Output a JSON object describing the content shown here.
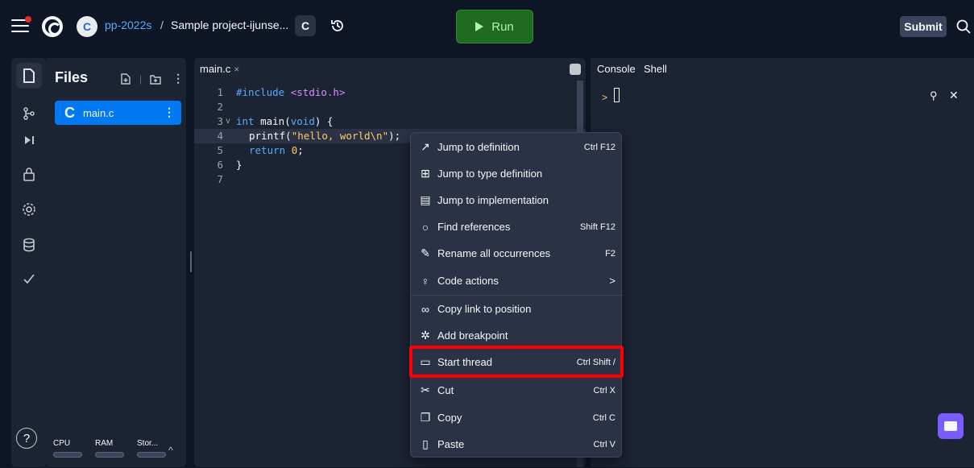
{
  "topbar": {
    "org": "pp-2022s",
    "separator": "/",
    "project": "Sample project-ijunse...",
    "lang_badge": "C",
    "run_label": "Run",
    "submit_label": "Submit"
  },
  "files_panel": {
    "title": "Files",
    "file_lang": "C",
    "file_name": "main.c",
    "resources": [
      "CPU",
      "RAM",
      "Stor..."
    ]
  },
  "editor": {
    "tab_label": "main.c",
    "tab_close": "×",
    "lines": [
      {
        "n": "1"
      },
      {
        "n": "2"
      },
      {
        "n": "3",
        "fold": "v"
      },
      {
        "n": "4"
      },
      {
        "n": "5"
      },
      {
        "n": "6"
      },
      {
        "n": "7"
      }
    ],
    "code": {
      "l1_kw": "#include",
      "l1_inc": "<stdio.h>",
      "l3_kw": "int",
      "l3_fn": "main(",
      "l3_kw2": "void",
      "l3_rest": ") {",
      "l4_fn": "printf(",
      "l4_str": "\"hello, world\\n\"",
      "l4_rest": ");",
      "l5_kw": "return",
      "l5_num": "0",
      "l5_rest": ";",
      "l6": "}"
    }
  },
  "console": {
    "tabs": [
      "Console",
      "Shell"
    ],
    "prompt": ">"
  },
  "context_menu": {
    "items": [
      {
        "label": "Jump to definition",
        "shortcut": "Ctrl F12",
        "icon": "open-external-icon"
      },
      {
        "label": "Jump to type definition",
        "shortcut": "",
        "icon": "book-icon"
      },
      {
        "label": "Jump to implementation",
        "shortcut": "",
        "icon": "code-file-icon"
      },
      {
        "label": "Find references",
        "shortcut": "Shift F12",
        "icon": "search-icon"
      },
      {
        "label": "Rename all occurrences",
        "shortcut": "F2",
        "icon": "pencil-icon"
      },
      {
        "label": "Code actions",
        "shortcut": ">",
        "icon": "lightbulb-icon"
      },
      {
        "label": "Copy link to position",
        "shortcut": "",
        "icon": "link-icon"
      },
      {
        "label": "Add breakpoint",
        "shortcut": "",
        "icon": "bug-icon"
      },
      {
        "label": "Start thread",
        "shortcut": "Ctrl Shift /",
        "icon": "comment-icon"
      },
      {
        "label": "Cut",
        "shortcut": "Ctrl X",
        "icon": "scissors-icon"
      },
      {
        "label": "Copy",
        "shortcut": "Ctrl C",
        "icon": "copy-icon"
      },
      {
        "label": "Paste",
        "shortcut": "Ctrl V",
        "icon": "clipboard-icon"
      }
    ]
  },
  "colors": {
    "accent": "#0079f2",
    "run": "#1e6b1f",
    "highlight": "#ff0000",
    "chat": "#7a5cff"
  }
}
